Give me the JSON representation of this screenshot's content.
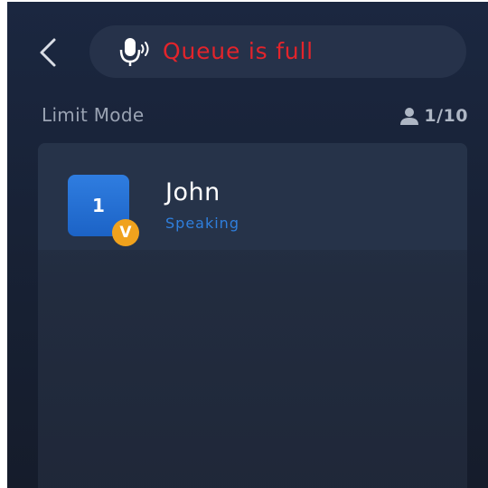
{
  "header": {
    "back_icon": "chevron-left-icon",
    "status": {
      "icon": "microphone-speaking-icon",
      "text": "Queue is full"
    }
  },
  "mode": {
    "label": "Limit Mode",
    "count_icon": "person-icon",
    "count": "1/10"
  },
  "members": [
    {
      "order": "1",
      "badge": "V",
      "name": "John",
      "status": "Speaking"
    }
  ],
  "colors": {
    "background": "#1b2740",
    "status_text": "#e3242b",
    "avatar": "#2f7de0",
    "badge": "#f0a21d",
    "speaking_status": "#2f7fdd"
  }
}
